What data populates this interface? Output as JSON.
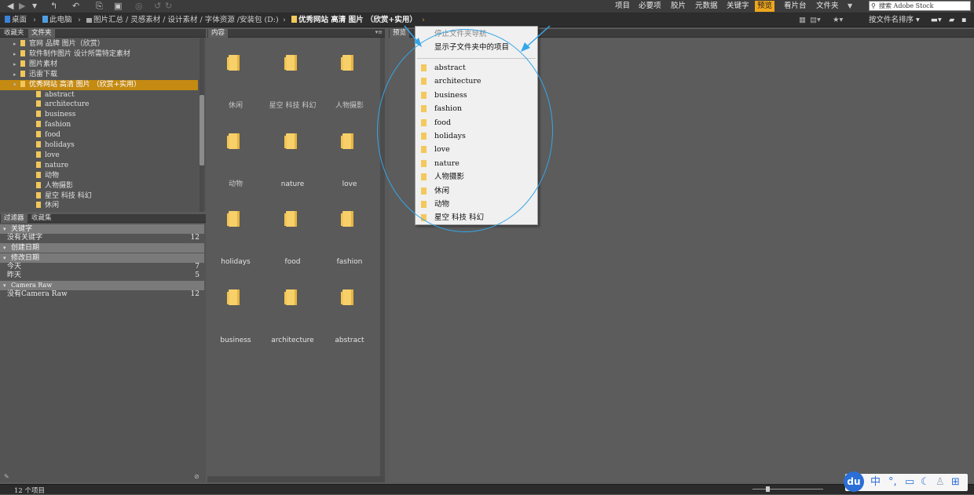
{
  "toolbar": {
    "workspaces": [
      "项目",
      "必要项",
      "胶片",
      "元数据",
      "关键字",
      "预览",
      "看片台",
      "文件夹"
    ],
    "active_workspace": "预览",
    "stock_search_placeholder": "搜索 Adobe Stock",
    "sort_label": "按文件名排序"
  },
  "path": {
    "items": [
      "桌面",
      "此电脑",
      "图片汇总 / 灵感素材 / 设计素材 / 字体资源 /安装包 (D:)",
      "优秀网站 高清 图片 （欣赏+实用）"
    ]
  },
  "left_panel": {
    "tabs": [
      "收藏夹",
      "文件夹"
    ],
    "tree": [
      {
        "label": "官网 品牌 图片（欣赏）",
        "level": 1
      },
      {
        "label": "软件制作图片 设计所需特定素材",
        "level": 1
      },
      {
        "label": "图片素材",
        "level": 1
      },
      {
        "label": "迅雷下载",
        "level": 1
      },
      {
        "label": "优秀网站 高清 图片 （欣赏+实用）",
        "level": 1,
        "selected": true
      },
      {
        "label": "abstract",
        "level": 2
      },
      {
        "label": "architecture",
        "level": 2
      },
      {
        "label": "business",
        "level": 2
      },
      {
        "label": "fashion",
        "level": 2
      },
      {
        "label": "food",
        "level": 2
      },
      {
        "label": "holidays",
        "level": 2
      },
      {
        "label": "love",
        "level": 2
      },
      {
        "label": "nature",
        "level": 2
      },
      {
        "label": "动物",
        "level": 2
      },
      {
        "label": "人物摄影",
        "level": 2
      },
      {
        "label": "星空 科技 科幻",
        "level": 2
      },
      {
        "label": "休闲",
        "level": 2
      }
    ]
  },
  "filter_panel": {
    "tabs": [
      "过滤器",
      "收藏集"
    ],
    "sections": [
      {
        "title": "关键字",
        "rows": [
          {
            "label": "没有关键字",
            "count": "12"
          }
        ]
      },
      {
        "title": "创建日期",
        "rows": []
      },
      {
        "title": "修改日期",
        "rows": [
          {
            "label": "今天",
            "count": "7"
          },
          {
            "label": "昨天",
            "count": "5"
          }
        ]
      },
      {
        "title": "Camera Raw",
        "rows": [
          {
            "label": "没有Camera Raw",
            "count": "12"
          }
        ]
      }
    ]
  },
  "content": {
    "tab": "内容",
    "items": [
      {
        "label": "休闲",
        "cn": true
      },
      {
        "label": "星空 科技 科幻",
        "cn": true
      },
      {
        "label": "人物摄影",
        "cn": true
      },
      {
        "label": "动物",
        "cn": true
      },
      {
        "label": "nature"
      },
      {
        "label": "love"
      },
      {
        "label": "holidays"
      },
      {
        "label": "food"
      },
      {
        "label": "fashion"
      },
      {
        "label": "business"
      },
      {
        "label": "architecture"
      },
      {
        "label": "abstract"
      }
    ]
  },
  "preview": {
    "tab": "预览"
  },
  "dropdown": {
    "stop_nav": "停止文件夹导航",
    "show_sub": "显示子文件夹中的项目",
    "folders": [
      "abstract",
      "architecture",
      "business",
      "fashion",
      "food",
      "holidays",
      "love",
      "nature",
      "人物摄影",
      "休闲",
      "动物",
      "星空 科技 科幻"
    ]
  },
  "status": {
    "count_text": "12 个项目"
  },
  "ime": {
    "logo": "du",
    "mode": "中"
  },
  "colors": {
    "accent": "#f0a71e",
    "selection": "#c48a12",
    "annotation": "#35a6e8"
  }
}
